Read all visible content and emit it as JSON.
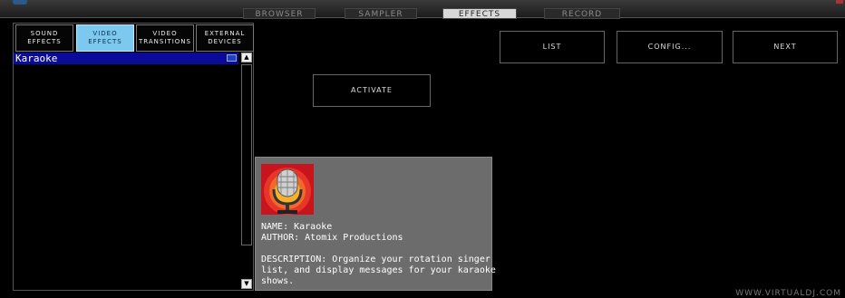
{
  "top_tabs": [
    "BROWSER",
    "SAMPLER",
    "EFFECTS",
    "RECORD"
  ],
  "active_tab": "EFFECTS",
  "categories": [
    {
      "line1": "SOUND",
      "line2": "EFFECTS"
    },
    {
      "line1": "VIDEO",
      "line2": "EFFECTS"
    },
    {
      "line1": "VIDEO",
      "line2": "TRANSITIONS"
    },
    {
      "line1": "EXTERNAL",
      "line2": "DEVICES"
    }
  ],
  "active_category": "VIDEO EFFECTS",
  "effects_list": [
    "Karaoke"
  ],
  "scrollbar": {
    "up": "▲",
    "down": "▼"
  },
  "buttons": {
    "activate": "ACTIVATE",
    "list": "LIST",
    "config": "CONFIG...",
    "next": "NEXT"
  },
  "info": {
    "name": "NAME: Karaoke",
    "author": "AUTHOR: Atomix Productions",
    "description_lines": [
      "DESCRIPTION: Organize your rotation singer",
      "list, and display messages for your karaoke",
      "shows."
    ]
  },
  "watermark": "WWW.VIRTUALDJ.COM",
  "colors": {
    "selected_row": "#0b0b9a",
    "active_category": "#7dc8ee",
    "info_panel": "#6c6c6c"
  }
}
